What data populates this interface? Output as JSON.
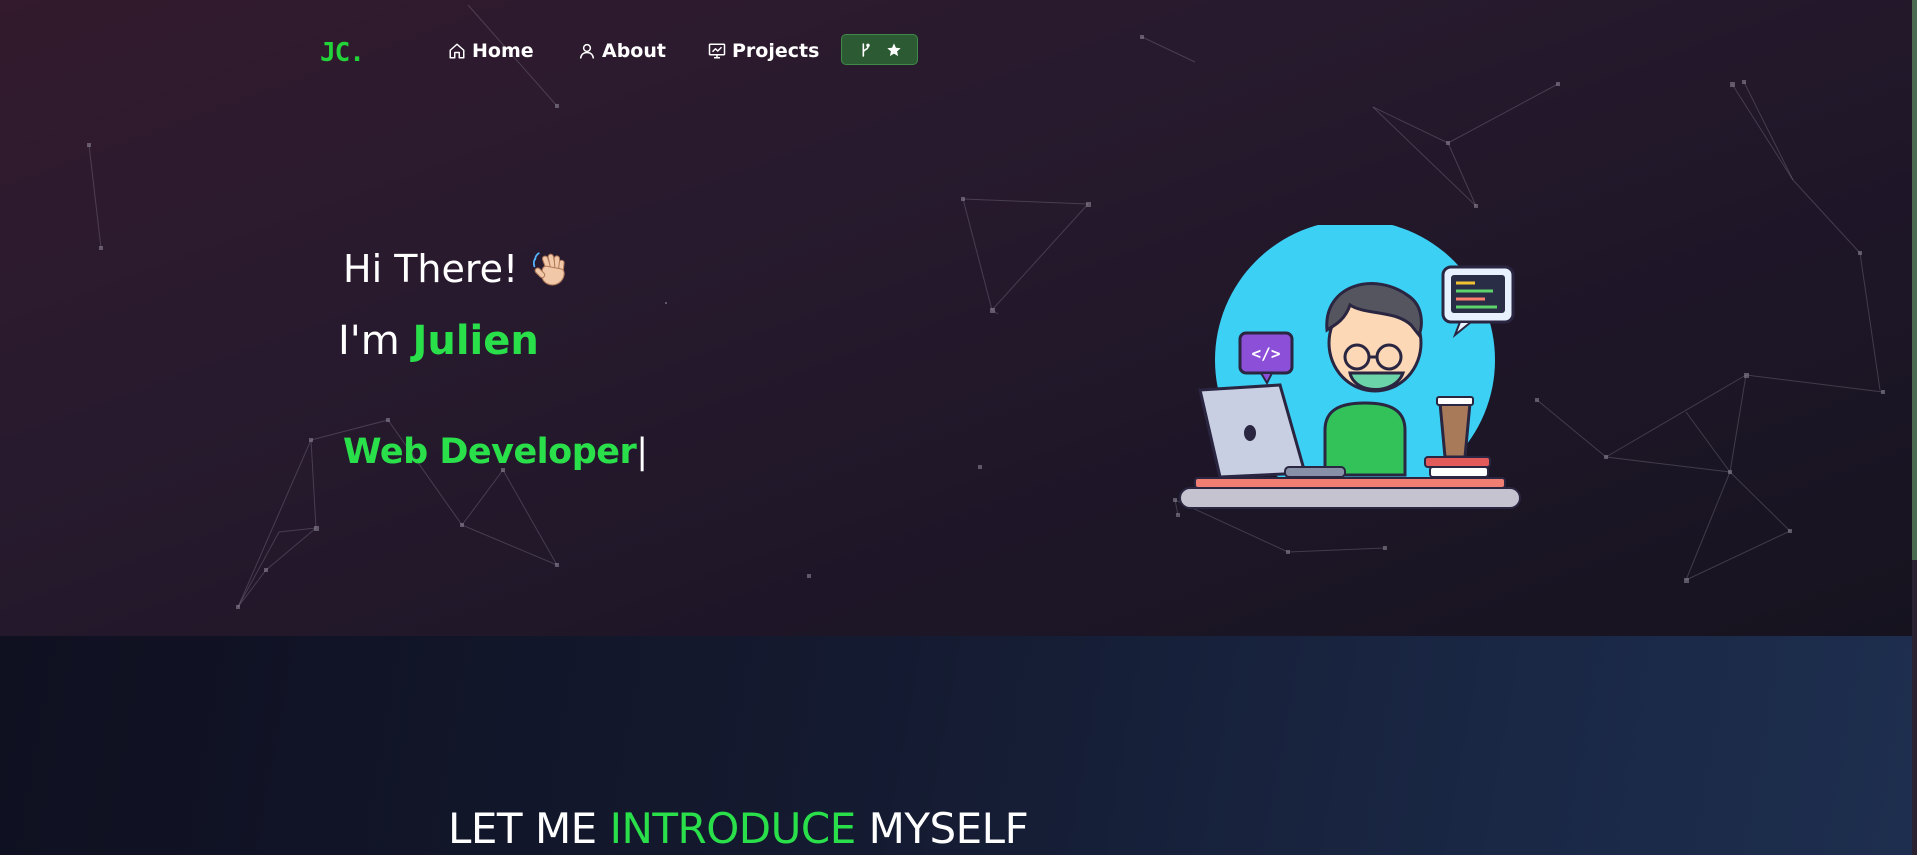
{
  "navbar": {
    "logo_text": "JC.",
    "items": [
      {
        "label": "Home",
        "icon": "home-icon"
      },
      {
        "label": "About",
        "icon": "user-icon"
      },
      {
        "label": "Projects",
        "icon": "projects-icon"
      }
    ],
    "github_button": {
      "icons": [
        "fork-icon",
        "star-icon"
      ]
    }
  },
  "hero": {
    "greeting": "Hi There!",
    "greeting_icon": "waving-hand-icon",
    "intro": "I'm",
    "name": "Julien",
    "role": "Web Developer",
    "cursor": "|",
    "illustration": "developer-at-laptop-illustration"
  },
  "about": {
    "title_part1": "LET ME ",
    "title_highlight": "INTRODUCE",
    "title_part2": " MYSELF"
  },
  "colors": {
    "accent": "#2ae04a",
    "hero_bg": "#281a2e",
    "about_bg": "#141a30",
    "text": "#ffffff",
    "github_button": "#2c5a32"
  }
}
